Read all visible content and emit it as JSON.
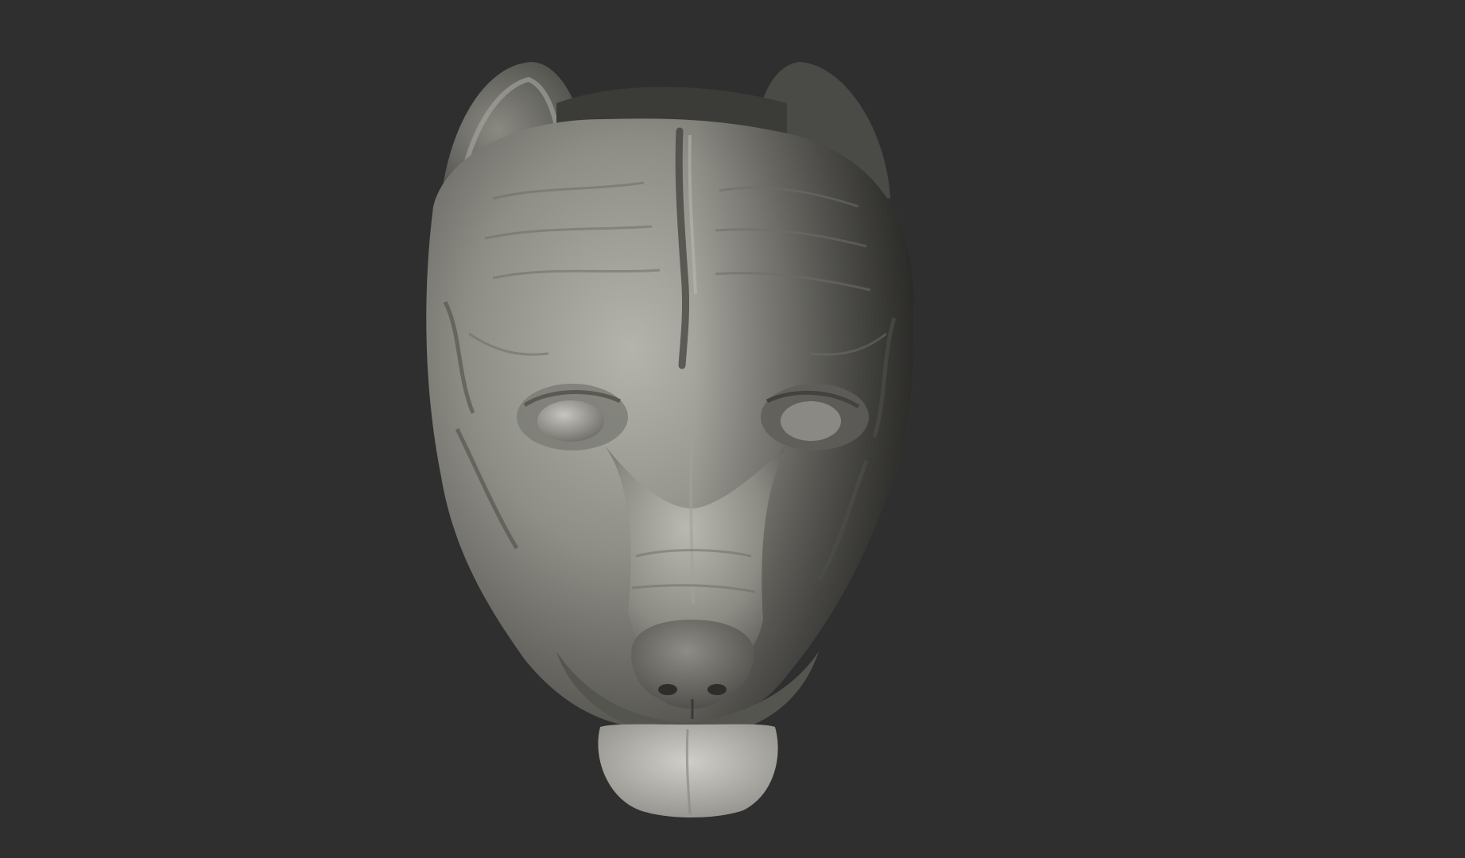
{
  "viewport": {
    "background_color": "#2f2f2f",
    "subject": "dog-head-sculpt",
    "material_color": "#9a9a92"
  }
}
